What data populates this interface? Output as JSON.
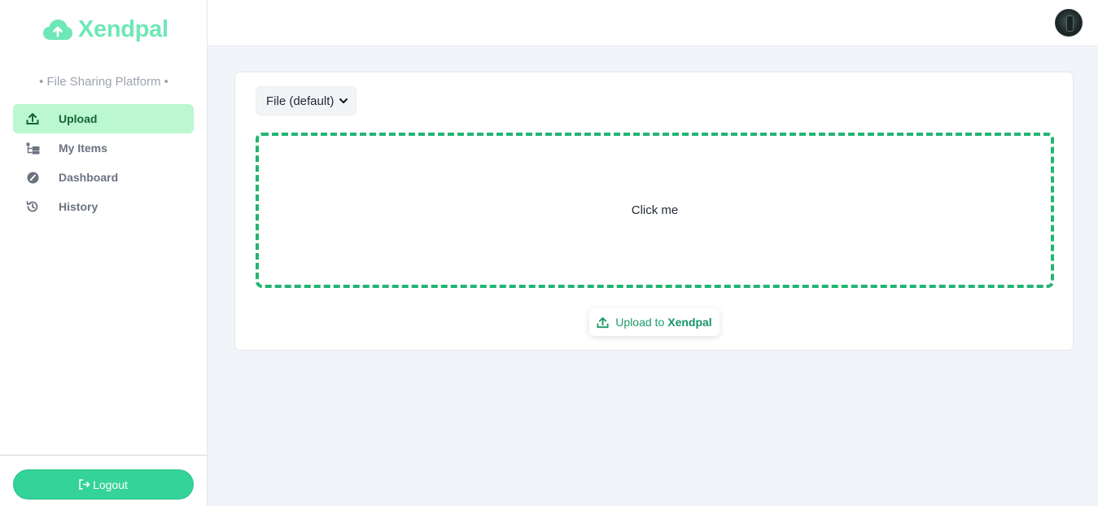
{
  "brand": {
    "name": "Xendpal",
    "tagline": "• File Sharing Platform •",
    "color": "#6ee7b7"
  },
  "sidebar": {
    "items": [
      {
        "label": "Upload",
        "icon": "upload-icon",
        "active": true
      },
      {
        "label": "My Items",
        "icon": "folder-tree-icon",
        "active": false
      },
      {
        "label": "Dashboard",
        "icon": "gauge-icon",
        "active": false
      },
      {
        "label": "History",
        "icon": "history-icon",
        "active": false
      }
    ],
    "logout_label": "Logout"
  },
  "upload_panel": {
    "type_select": {
      "selected": "File (default)"
    },
    "dropzone_label": "Click me",
    "upload_button": {
      "prefix": "Upload to",
      "brand": "Xendpal"
    }
  },
  "colors": {
    "accent": "#34d399",
    "active_bg": "#bbf7d0",
    "dashed_border": "#22b573"
  }
}
